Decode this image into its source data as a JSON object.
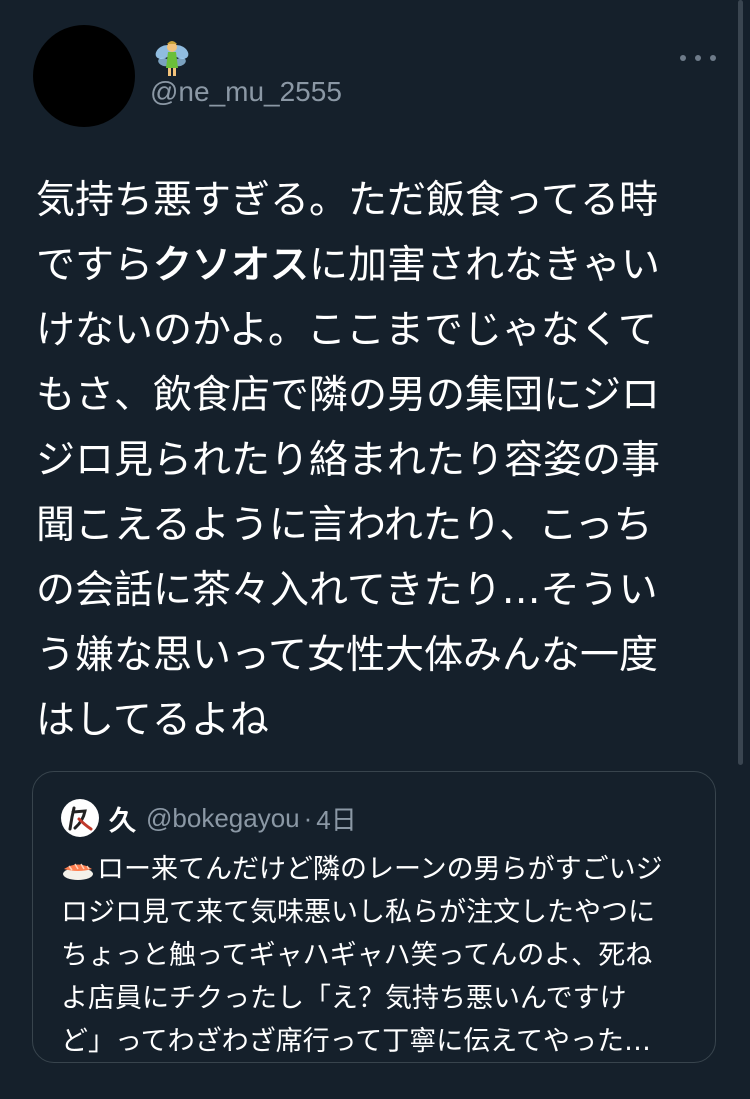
{
  "author": {
    "avatar": "black-circle-avatar",
    "name_emoji": "fairy-emoji",
    "handle": "@ne_mu_2555"
  },
  "more_icon": "more-horizontal-icon",
  "tweet": {
    "lines": [
      {
        "pre": "気持ち悪すぎる。ただ飯食ってる時",
        "bold": "",
        "post": ""
      },
      {
        "pre": "ですら",
        "bold": "クソオス",
        "post": "に加害されなきゃい"
      },
      {
        "pre": "けないのかよ。ここまでじゃなくて",
        "bold": "",
        "post": ""
      },
      {
        "pre": "もさ、飲食店で隣の男の集団にジロ",
        "bold": "",
        "post": ""
      },
      {
        "pre": "ジロ見られたり絡まれたり容姿の事",
        "bold": "",
        "post": ""
      },
      {
        "pre": "聞こえるように言われたり、こっち",
        "bold": "",
        "post": ""
      },
      {
        "pre": "の会話に茶々入れてきたり…そうい",
        "bold": "",
        "post": ""
      },
      {
        "pre": "う嫌な思いって女性大体みんな一度",
        "bold": "",
        "post": ""
      },
      {
        "pre": "はしてるよね",
        "bold": "",
        "post": ""
      }
    ]
  },
  "quote": {
    "avatar_icon": "ku-character-avatar",
    "name": "久",
    "handle": "@bokegayou",
    "dot": "·",
    "time": "4日",
    "emoji": "sushi-icon",
    "lines": [
      "ロー来てんだけど隣のレーンの男らがすごいジ",
      "ロジロ見て来て気味悪いし私らが注文したやつに",
      "ちょっと触ってギャハギャハ笑ってんのよ、死ね",
      "よ店員にチクったし「え？気持ち悪いんですけ",
      "ど」ってわざわざ席行って丁寧に伝えてやった…"
    ]
  },
  "colors": {
    "background": "#15202b",
    "secondary_text": "#8b98a5",
    "border": "#38444d",
    "text": "#ffffff"
  }
}
